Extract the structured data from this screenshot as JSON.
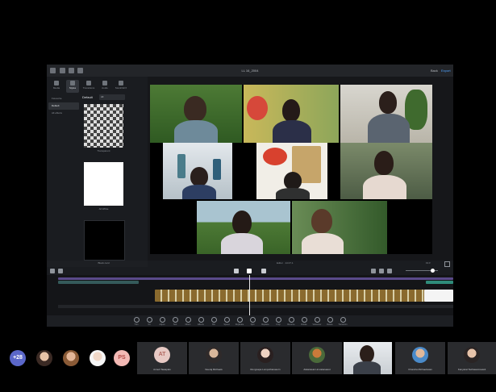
{
  "editor": {
    "title": "LL 16_2004",
    "back_label": "Back",
    "export_label": "Export",
    "tabs": [
      "Media",
      "Styles",
      "Transitions",
      "Audio",
      "Stock/GFX"
    ],
    "left_items": [
      "Favourite",
      "Default",
      "All effects"
    ],
    "style_header": "Default",
    "style_dropdown": "All",
    "style_thumbs": [
      "Transparent",
      "All White",
      "Black card"
    ],
    "viewer_label": "Editor · 14:27.1",
    "zoom_label": "Fit ▾",
    "tools": [
      "Trim",
      "Fit",
      "Adjust",
      "Text",
      "Filters",
      "Effects",
      "BG",
      "Speed",
      "Duplicate",
      "Split",
      "Replace",
      "Crop",
      "Reverse",
      "Rotate",
      "Voiceover",
      "Delete",
      "Transform"
    ]
  },
  "call": {
    "overflow_count": "+28",
    "avatar_initials": [
      "PS"
    ],
    "participants": [
      {
        "initials": "AT",
        "name": "Anneli Tawapalo"
      },
      {
        "initials": "",
        "name": "Neeraj Michaels"
      },
      {
        "initials": "",
        "name": "Rungnapa Lumpothanasorn"
      },
      {
        "initials": "",
        "name": "Akkarawat Limvatanawut"
      },
      {
        "initials": "",
        "name": ""
      },
      {
        "initials": "",
        "name": "Chandra Michaelswan"
      },
      {
        "initials": "",
        "name": "Kanyarat Tachasamrauwit"
      }
    ]
  },
  "colors": {
    "accent": "#4fa3ff",
    "avatar_plus": "#5b67c9",
    "avatar_ps": "#f3b9b4",
    "avatar_at": "#e7c9c4",
    "timeline_track": "#8a6a2e"
  },
  "icons": [
    "back-icon",
    "undo-icon",
    "redo-icon",
    "play-icon",
    "pause-icon",
    "scissors-icon"
  ]
}
